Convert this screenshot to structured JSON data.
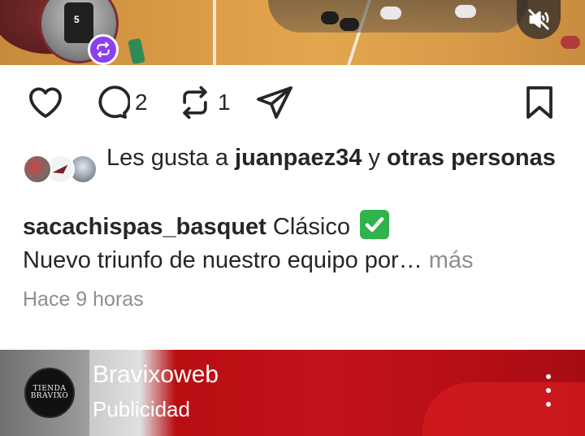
{
  "post": {
    "actions": {
      "comment_count": "2",
      "repost_count": "1"
    },
    "likes": {
      "prefix": "Les gusta a",
      "user": "juanpaez34",
      "joiner": "y",
      "others": "otras personas"
    },
    "caption": {
      "username": "sacachispas_basquet",
      "line1_text": "Clásico",
      "line2_text": "Nuevo triunfo de nuestro equipo  por…",
      "more_label": "más"
    },
    "timestamp": "Hace 9 horas",
    "jersey_number": "5"
  },
  "next_post": {
    "account_name": "Bravixoweb",
    "label": "Publicidad",
    "logo_text_top": "TIENDA",
    "logo_text_bottom": "BRAVIXO"
  },
  "icons": {
    "like": "heart-icon",
    "comment": "comment-icon",
    "repost": "repost-icon",
    "share": "send-icon",
    "save": "bookmark-icon",
    "mute": "speaker-muted-icon",
    "more": "more-vertical-icon"
  },
  "colors": {
    "text": "#262626",
    "secondary": "#8e8e8e",
    "repost_badge": "#8b3ff0",
    "check": "#2fb34a"
  }
}
